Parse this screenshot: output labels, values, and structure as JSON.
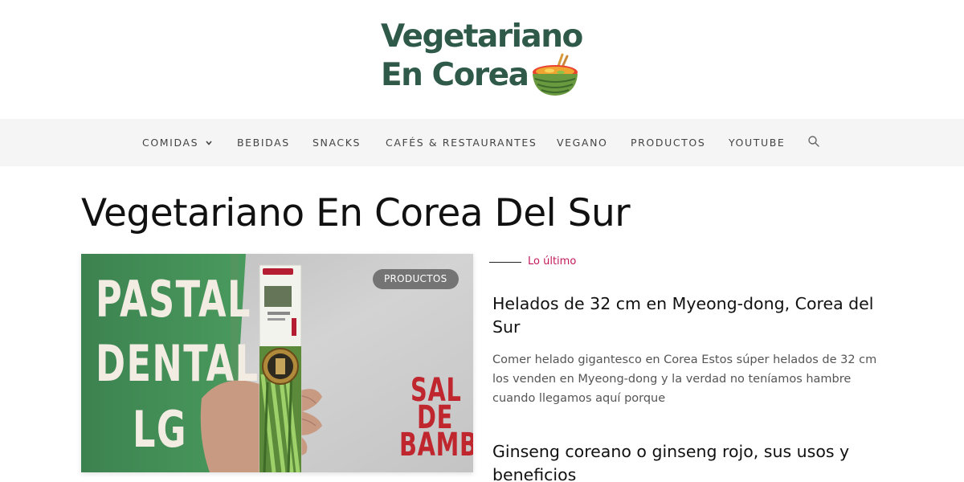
{
  "header": {
    "logo_line1": "Vegetariano",
    "logo_line2": "En Corea"
  },
  "nav": {
    "items": [
      {
        "label": "COMIDAS",
        "has_dropdown": true
      },
      {
        "label": "BEBIDAS"
      },
      {
        "label": "SNACKS"
      },
      {
        "label": "CAFÉS & RESTAURANTES"
      },
      {
        "label": "VEGANO"
      },
      {
        "label": "PRODUCTOS"
      },
      {
        "label": "YOUTUBE"
      }
    ],
    "search_icon": "search-icon"
  },
  "page": {
    "title": "Vegetariano En Corea Del Sur"
  },
  "featured": {
    "badge": "PRODUCTOS",
    "image_text_left": [
      "PASTAL",
      "DENTAL",
      "LG"
    ],
    "image_text_right": [
      "SAL",
      "DE",
      "BAMBÚ"
    ]
  },
  "latest": {
    "label": "Lo último",
    "posts": [
      {
        "title": "Helados de 32 cm en Myeong-dong, Corea del Sur",
        "excerpt": "Comer helado gigantesco en Corea Estos súper helados de 32 cm los venden en Myeong-dong y la verdad no teníamos hambre cuando llegamos aquí porque"
      },
      {
        "title": "Ginseng coreano o ginseng rojo, sus usos y beneficios"
      }
    ]
  },
  "colors": {
    "logo_green": "#2f5a4a",
    "accent_pink": "#c2185b",
    "nav_bg": "#f5f5f5",
    "image_green": "#3f8a52",
    "image_red": "#c0262d"
  }
}
